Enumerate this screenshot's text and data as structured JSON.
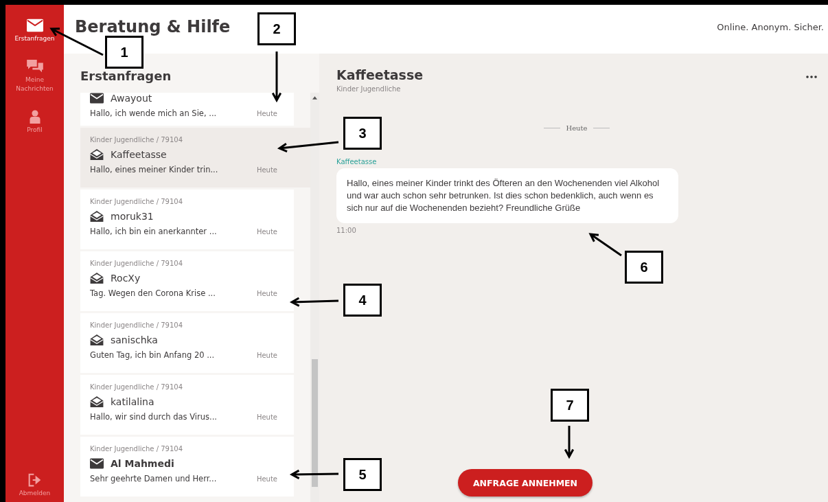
{
  "sidebar": {
    "items": [
      {
        "label": "Erstanfragen",
        "kind": "inbox",
        "selected": true
      },
      {
        "label": "Meine Nachrichten",
        "kind": "messages",
        "selected": false
      },
      {
        "label": "Profil",
        "kind": "profile",
        "selected": false
      }
    ],
    "logout": "Abmelden"
  },
  "header": {
    "title": "Beratung & Hilfe",
    "tagline": "Online. Anonym. Sicher."
  },
  "inbox": {
    "title": "Erstanfragen",
    "items": [
      {
        "name": "Awayout",
        "preview": "Hallo, ich wende mich an Sie, ...",
        "date": "Heute",
        "unread": true,
        "selected": false
      },
      {
        "meta": "Kinder Jugendliche / 79104",
        "name": "Kaffeetasse",
        "preview": "Hallo, eines meiner Kinder trin...",
        "date": "Heute",
        "unread": false,
        "selected": true
      },
      {
        "meta": "Kinder Jugendliche / 79104",
        "name": "moruk31",
        "preview": "Hallo, ich bin ein anerkannter ...",
        "date": "Heute",
        "unread": false,
        "selected": false
      },
      {
        "meta": "Kinder Jugendliche / 79104",
        "name": "RocXy",
        "preview": "Tag. Wegen den Corona Krise ...",
        "date": "Heute",
        "unread": false,
        "selected": false
      },
      {
        "meta": "Kinder Jugendliche / 79104",
        "name": "sanischka",
        "preview": "Guten Tag, ich bin Anfang 20 ...",
        "date": "Heute",
        "unread": false,
        "selected": false
      },
      {
        "meta": "Kinder Jugendliche / 79104",
        "name": "katilalina",
        "preview": "Hallo, wir sind durch das Virus...",
        "date": "Heute",
        "unread": false,
        "selected": false
      },
      {
        "meta": "Kinder Jugendliche / 79104",
        "name": "Al Mahmedi",
        "preview": "Sehr geehrte Damen und Herr...",
        "date": "Heute",
        "unread": true,
        "selected": false
      }
    ]
  },
  "chat": {
    "title": "Kaffeetasse",
    "subtitle": "Kinder Jugendliche",
    "day": "Heute",
    "messages": [
      {
        "sender": "Kaffeetasse",
        "text": "Hallo, eines meiner Kinder trinkt des Öfteren an den Wochenenden viel Alkohol und war auch schon sehr betrunken. Ist dies schon bedenklich, auch wenn es sich nur auf die Wochenenden bezieht? Freundliche Grüße",
        "time": "11:00"
      }
    ],
    "action": "ANFRAGE ANNEHMEN"
  },
  "callouts": [
    {
      "label": "1"
    },
    {
      "label": "2"
    },
    {
      "label": "3"
    },
    {
      "label": "4"
    },
    {
      "label": "5"
    },
    {
      "label": "6"
    },
    {
      "label": "7"
    }
  ]
}
